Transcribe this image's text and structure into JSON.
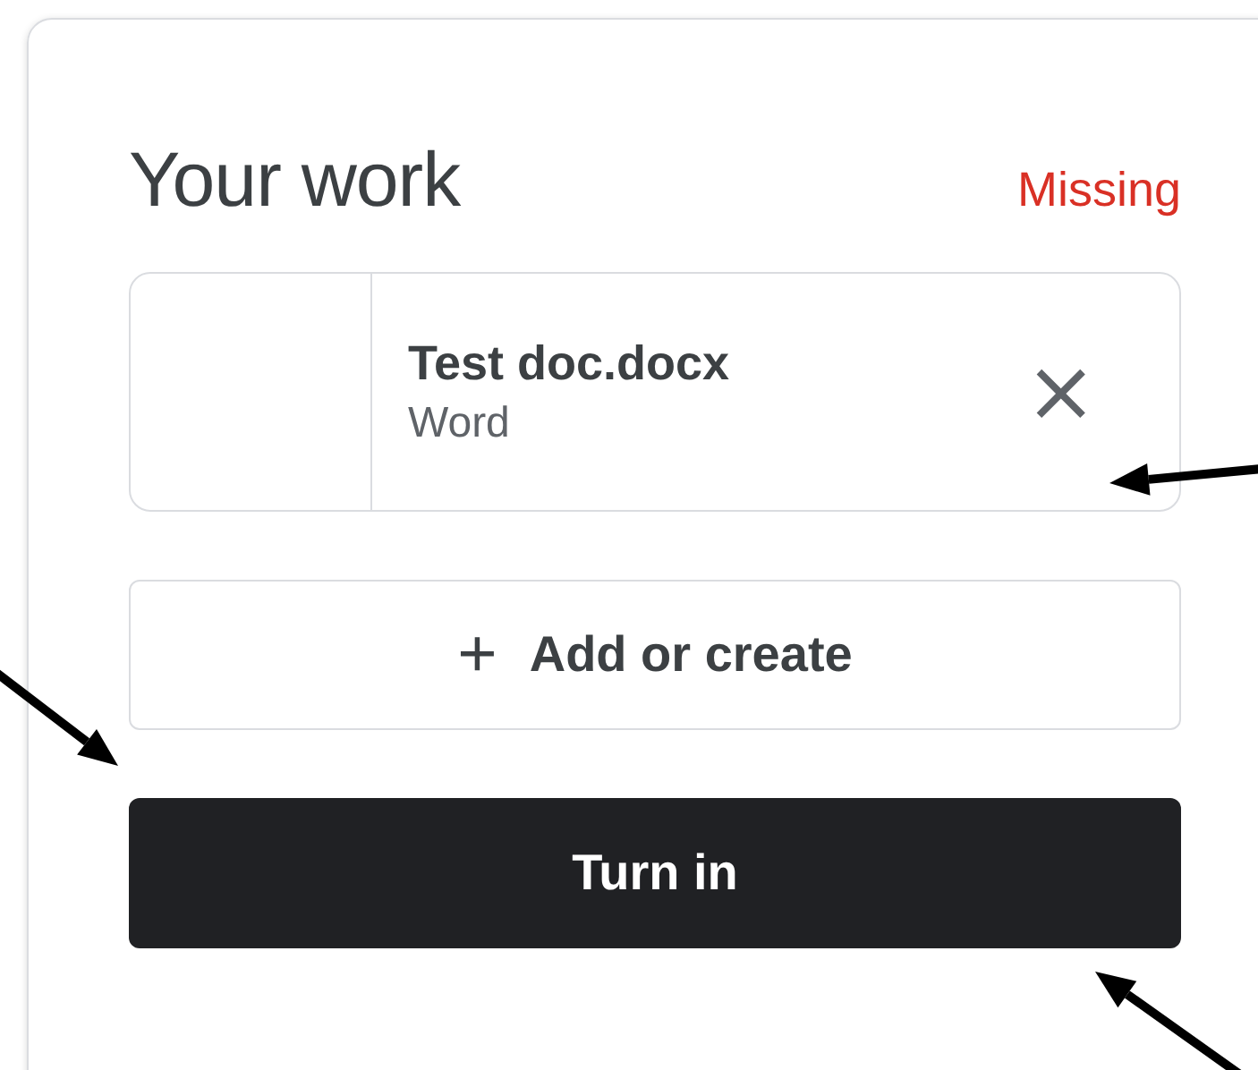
{
  "card": {
    "title": "Your work",
    "status": "Missing",
    "attachments": [
      {
        "name": "Test doc.docx",
        "type": "Word",
        "remove": "×"
      }
    ],
    "add_button": {
      "icon": "+",
      "label": "Add or create"
    },
    "turn_in_button": {
      "label": "Turn in"
    }
  }
}
